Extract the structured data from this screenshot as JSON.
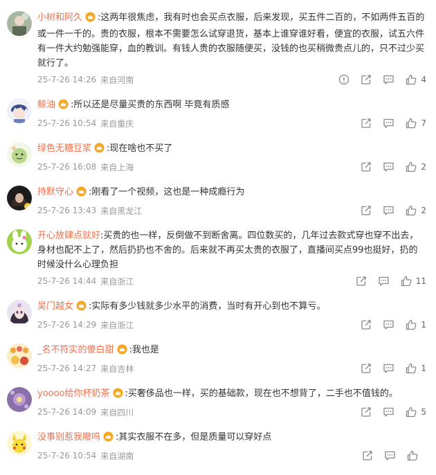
{
  "comments": [
    {
      "name": "小树和阿久",
      "text": ":这两年很焦虑，我有时也会买点衣服，后来发现，买五件二百的，不如两件五百的或一件一千的。贵的衣服，根本不需要怎么试穿退货，基本上谁穿谁好看，便宜的衣服，试五六件有一件大约勉强能穿，血的教训。有钱人贵的衣服随便买，没钱的也买稍微贵点儿的，只不过少买就行了。",
      "time": "25-7-26 14:26",
      "location": "来自河南",
      "likes": "4"
    },
    {
      "name": "鲸油",
      "text": ":所以还是尽量买贵的东西啊 毕竟有质感",
      "time": "25-7-26 10:54",
      "location": "来自重庆",
      "likes": "7"
    },
    {
      "name": "绿色无糖豆浆",
      "text": ":现在啥也不买了",
      "time": "25-7-26 16:08",
      "location": "来自上海",
      "likes": "2"
    },
    {
      "name": "持默守心",
      "text": ":刚看了一个视频，这也是一种成瘾行为",
      "time": "25-7-26 13:43",
      "location": "来自黑龙江",
      "likes": "2"
    },
    {
      "name": "开心放肆点就好",
      "text": ":买贵的也一样，反倒做不到断舍离。四位数买的，几年过去款式穿也穿不出去，身材也配不上了，然后扔扔也不舍的。后来就不再买太贵的衣服了，直播间买点99也挺好，扔的时候没什么心理负担",
      "time": "25-7-26 14:44",
      "location": "来自浙江",
      "likes": "11"
    },
    {
      "name": "吴门越女",
      "text": ":实际有多少钱就多少水平的消费，当时有开心到也不算亏。",
      "time": "25-7-26 14:29",
      "location": "来自浙江",
      "likes": "1"
    },
    {
      "name": "_名不符实的傻白甜",
      "text": ":我也是",
      "time": "25-7-26 14:27",
      "location": "来自吉林",
      "likes": "1"
    },
    {
      "name": "yoooo给你杯奶茶",
      "text": ":买奢侈品也一样，买的基础款，现在也不想背了，二手也不值钱的。",
      "time": "25-7-26 14:09",
      "location": "来自四川",
      "likes": "5"
    },
    {
      "name": "没事别惹我嗷呜",
      "text": ":其实衣服不在多，但是质量可以穿好点",
      "time": "25-7-26 10:54",
      "location": "来自湖南",
      "likes": ""
    }
  ],
  "icons": {
    "vip": "crown-badge-icon",
    "report": "report-icon",
    "share": "share-icon",
    "comment": "comment-icon",
    "like": "thumbs-up-icon"
  },
  "colors": {
    "name": "#eb7350",
    "meta": "#999999",
    "text": "#333333",
    "vip_badge": "#f5a623"
  }
}
